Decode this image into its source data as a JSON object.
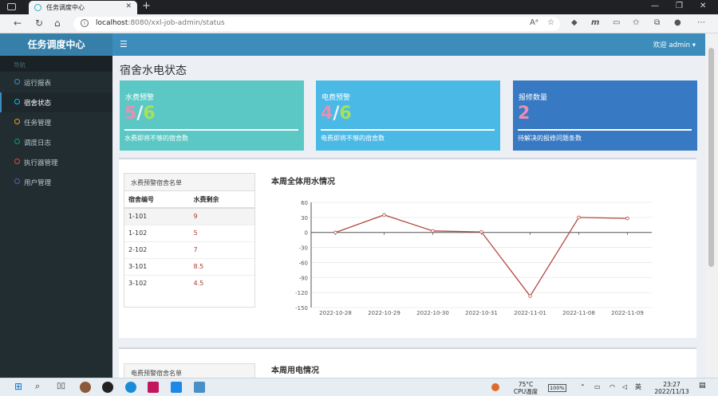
{
  "browser": {
    "tab_title": "任务调度中心",
    "url_host": "localhost",
    "url_path": ":8080/xxl-job-admin/status"
  },
  "app": {
    "brand": "任务调度中心",
    "user_menu": "欢迎 admin"
  },
  "sidebar": {
    "header": "导航",
    "items": [
      {
        "label": "运行报表",
        "color": "#3c8dbc"
      },
      {
        "label": "宿舍状态",
        "color": "#00c0ef"
      },
      {
        "label": "任务管理",
        "color": "#f39c12"
      },
      {
        "label": "调度日志",
        "color": "#00a65a"
      },
      {
        "label": "执行器管理",
        "color": "#dd4b39"
      },
      {
        "label": "用户管理",
        "color": "#605ca8"
      }
    ]
  },
  "page": {
    "title": "宿舍水电状态"
  },
  "info_boxes": [
    {
      "title": "水费预警",
      "value_a": "5",
      "sep": "/",
      "value_b": "6",
      "desc": "水费即将不够的宿舍数",
      "color": "#5bc8c5"
    },
    {
      "title": "电费预警",
      "value_a": "4",
      "sep": "/",
      "value_b": "6",
      "desc": "电费即将不够的宿舍数",
      "color": "#4ab9e6"
    },
    {
      "title": "报修数量",
      "value_a": "2",
      "sep": "",
      "value_b": "",
      "desc": "待解决的报修问题条数",
      "color": "#3779c3"
    }
  ],
  "water_table": {
    "title": "水费预警宿舍名单",
    "col_room": "宿舍编号",
    "col_value": "水费剩余",
    "rows": [
      {
        "room": "1-101",
        "value": "9"
      },
      {
        "room": "1-102",
        "value": "5"
      },
      {
        "room": "2-102",
        "value": "7"
      },
      {
        "room": "3-101",
        "value": "8.5"
      },
      {
        "room": "3-102",
        "value": "4.5"
      }
    ]
  },
  "electric_table": {
    "title": "电费预警宿舍名单"
  },
  "water_chart_title": "本周全体用水情况",
  "electric_chart_title": "本周用电情况",
  "chart_data": {
    "type": "line",
    "title": "本周全体用水情况",
    "categories": [
      "2022-10-28",
      "2022-10-29",
      "2022-10-30",
      "2022-10-31",
      "2022-11-01",
      "2022-11-08",
      "2022-11-09"
    ],
    "values": [
      0,
      35,
      3,
      1,
      -127,
      30,
      28
    ],
    "ylim": [
      -150,
      60
    ],
    "yticks": [
      60,
      30,
      0,
      -30,
      -60,
      -90,
      -120,
      -150
    ],
    "color": "#b34a45"
  },
  "taskbar": {
    "weather_temp": "75°C",
    "weather_label": "CPU温度",
    "battery": "100%",
    "time": "23:27",
    "date": "2022/11/13"
  }
}
